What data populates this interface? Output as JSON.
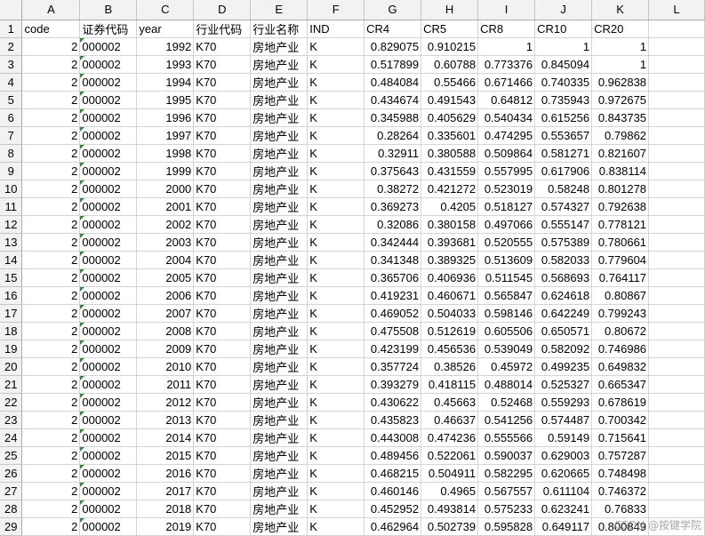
{
  "sheet": {
    "columns": [
      "A",
      "B",
      "C",
      "D",
      "E",
      "F",
      "G",
      "H",
      "I",
      "J",
      "K",
      "L"
    ],
    "headers": [
      "code",
      "证券代码",
      "year",
      "行业代码",
      "行业名称",
      "IND",
      "CR4",
      "CR5",
      "CR8",
      "CR10",
      "CR20",
      ""
    ],
    "rows": [
      [
        "2",
        "000002",
        "1992",
        "K70",
        "房地产业",
        "K",
        "0.829075",
        "0.910215",
        "1",
        "1",
        "1",
        ""
      ],
      [
        "2",
        "000002",
        "1993",
        "K70",
        "房地产业",
        "K",
        "0.517899",
        "0.60788",
        "0.773376",
        "0.845094",
        "1",
        ""
      ],
      [
        "2",
        "000002",
        "1994",
        "K70",
        "房地产业",
        "K",
        "0.484084",
        "0.55466",
        "0.671466",
        "0.740335",
        "0.962838",
        ""
      ],
      [
        "2",
        "000002",
        "1995",
        "K70",
        "房地产业",
        "K",
        "0.434674",
        "0.491543",
        "0.64812",
        "0.735943",
        "0.972675",
        ""
      ],
      [
        "2",
        "000002",
        "1996",
        "K70",
        "房地产业",
        "K",
        "0.345988",
        "0.405629",
        "0.540434",
        "0.615256",
        "0.843735",
        ""
      ],
      [
        "2",
        "000002",
        "1997",
        "K70",
        "房地产业",
        "K",
        "0.28264",
        "0.335601",
        "0.474295",
        "0.553657",
        "0.79862",
        ""
      ],
      [
        "2",
        "000002",
        "1998",
        "K70",
        "房地产业",
        "K",
        "0.32911",
        "0.380588",
        "0.509864",
        "0.581271",
        "0.821607",
        ""
      ],
      [
        "2",
        "000002",
        "1999",
        "K70",
        "房地产业",
        "K",
        "0.375643",
        "0.431559",
        "0.557995",
        "0.617906",
        "0.838114",
        ""
      ],
      [
        "2",
        "000002",
        "2000",
        "K70",
        "房地产业",
        "K",
        "0.38272",
        "0.421272",
        "0.523019",
        "0.58248",
        "0.801278",
        ""
      ],
      [
        "2",
        "000002",
        "2001",
        "K70",
        "房地产业",
        "K",
        "0.369273",
        "0.4205",
        "0.518127",
        "0.574327",
        "0.792638",
        ""
      ],
      [
        "2",
        "000002",
        "2002",
        "K70",
        "房地产业",
        "K",
        "0.32086",
        "0.380158",
        "0.497066",
        "0.555147",
        "0.778121",
        ""
      ],
      [
        "2",
        "000002",
        "2003",
        "K70",
        "房地产业",
        "K",
        "0.342444",
        "0.393681",
        "0.520555",
        "0.575389",
        "0.780661",
        ""
      ],
      [
        "2",
        "000002",
        "2004",
        "K70",
        "房地产业",
        "K",
        "0.341348",
        "0.389325",
        "0.513609",
        "0.582033",
        "0.779604",
        ""
      ],
      [
        "2",
        "000002",
        "2005",
        "K70",
        "房地产业",
        "K",
        "0.365706",
        "0.406936",
        "0.511545",
        "0.568693",
        "0.764117",
        ""
      ],
      [
        "2",
        "000002",
        "2006",
        "K70",
        "房地产业",
        "K",
        "0.419231",
        "0.460671",
        "0.565847",
        "0.624618",
        "0.80867",
        ""
      ],
      [
        "2",
        "000002",
        "2007",
        "K70",
        "房地产业",
        "K",
        "0.469052",
        "0.504033",
        "0.598146",
        "0.642249",
        "0.799243",
        ""
      ],
      [
        "2",
        "000002",
        "2008",
        "K70",
        "房地产业",
        "K",
        "0.475508",
        "0.512619",
        "0.605506",
        "0.650571",
        "0.80672",
        ""
      ],
      [
        "2",
        "000002",
        "2009",
        "K70",
        "房地产业",
        "K",
        "0.423199",
        "0.456536",
        "0.539049",
        "0.582092",
        "0.746986",
        ""
      ],
      [
        "2",
        "000002",
        "2010",
        "K70",
        "房地产业",
        "K",
        "0.357724",
        "0.38526",
        "0.45972",
        "0.499235",
        "0.649832",
        ""
      ],
      [
        "2",
        "000002",
        "2011",
        "K70",
        "房地产业",
        "K",
        "0.393279",
        "0.418115",
        "0.488014",
        "0.525327",
        "0.665347",
        ""
      ],
      [
        "2",
        "000002",
        "2012",
        "K70",
        "房地产业",
        "K",
        "0.430622",
        "0.45663",
        "0.52468",
        "0.559293",
        "0.678619",
        ""
      ],
      [
        "2",
        "000002",
        "2013",
        "K70",
        "房地产业",
        "K",
        "0.435823",
        "0.46637",
        "0.541256",
        "0.574487",
        "0.700342",
        ""
      ],
      [
        "2",
        "000002",
        "2014",
        "K70",
        "房地产业",
        "K",
        "0.443008",
        "0.474236",
        "0.555566",
        "0.59149",
        "0.715641",
        ""
      ],
      [
        "2",
        "000002",
        "2015",
        "K70",
        "房地产业",
        "K",
        "0.489456",
        "0.522061",
        "0.590037",
        "0.629003",
        "0.757287",
        ""
      ],
      [
        "2",
        "000002",
        "2016",
        "K70",
        "房地产业",
        "K",
        "0.468215",
        "0.504911",
        "0.582295",
        "0.620665",
        "0.748498",
        ""
      ],
      [
        "2",
        "000002",
        "2017",
        "K70",
        "房地产业",
        "K",
        "0.460146",
        "0.4965",
        "0.567557",
        "0.611104",
        "0.746372",
        ""
      ],
      [
        "2",
        "000002",
        "2018",
        "K70",
        "房地产业",
        "K",
        "0.452952",
        "0.493814",
        "0.575233",
        "0.623241",
        "0.76833",
        ""
      ],
      [
        "2",
        "000002",
        "2019",
        "K70",
        "房地产业",
        "K",
        "0.462964",
        "0.502739",
        "0.595828",
        "0.649117",
        "0.800849",
        ""
      ]
    ],
    "watermark": "CSDN @按键学院"
  }
}
